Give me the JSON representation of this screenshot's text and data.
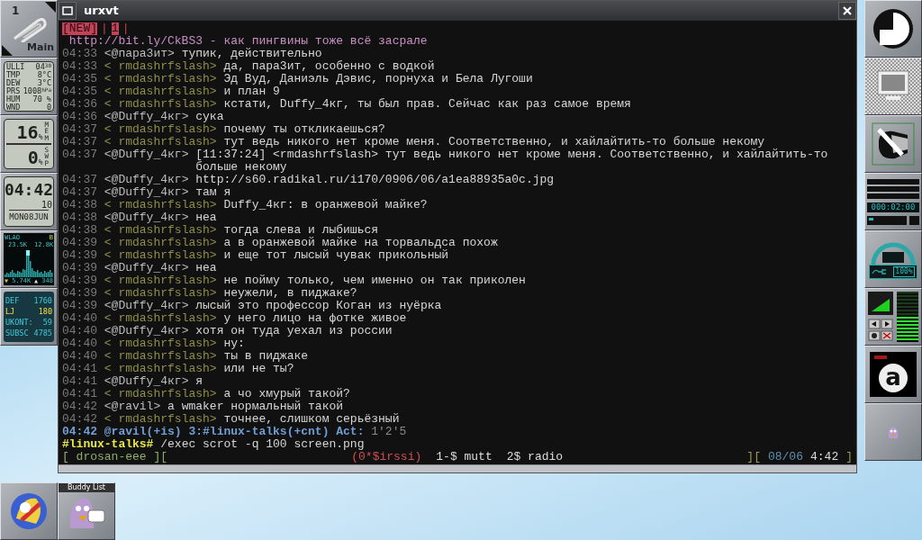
{
  "left_dock": {
    "workspace": {
      "number": "1",
      "name": "Main"
    },
    "weather": [
      {
        "label": "ULLI",
        "value": "04$^{30}$"
      },
      {
        "label": "TMP",
        "value": "8°C"
      },
      {
        "label": "DEW",
        "value": "3°C"
      },
      {
        "label": "PRS",
        "value": "1008$^{hPa}$"
      },
      {
        "label": "HUM",
        "value": "70 %"
      },
      {
        "label": "WND",
        "value": "0"
      }
    ],
    "memory": [
      {
        "value": "16",
        "unit": "%",
        "label": "MEM"
      },
      {
        "value": "0",
        "unit": "%",
        "label": "SWP"
      }
    ],
    "clock": {
      "time": "04:42",
      "seconds": "10",
      "date": "MON08JUN"
    },
    "network": {
      "interface": "WLAO",
      "flag": "B",
      "rx_total": "23.5K",
      "tx_total": "12.8K",
      "rx_rate": "5.74K",
      "tx_rate": "348"
    },
    "counters": [
      {
        "label": "DEF",
        "value": "1760",
        "highlighted": false
      },
      {
        "label": "LJ",
        "value": "180",
        "highlighted": true
      },
      {
        "label": "UKONT:",
        "value": "59",
        "highlighted": false
      },
      {
        "label": "SUBSC",
        "value": "4785",
        "highlighted": false
      }
    ]
  },
  "window": {
    "title": "urxvt"
  },
  "terminal": {
    "tabs": [
      {
        "label": "[NEW]",
        "kind": "hot"
      },
      {
        "label": "|",
        "kind": "sep"
      },
      {
        "label": "1",
        "kind": "hot"
      },
      {
        "label": "|",
        "kind": "sep"
      }
    ],
    "topic": " http://bit.ly/CkBS3 - как пингвины тоже всё засрале",
    "messages": [
      {
        "time": "04:33",
        "nick": "<@пара3ит>",
        "own": false,
        "text": "тупик, действительно"
      },
      {
        "time": "04:33",
        "nick": "< rmdashrfslash>",
        "own": true,
        "text": "да, пара3ит, особенно с водкой"
      },
      {
        "time": "04:35",
        "nick": "< rmdashrfslash>",
        "own": true,
        "text": "Эд Вуд, Даниэль Дэвис, порнуха и Бела Лугоши"
      },
      {
        "time": "04:35",
        "nick": "< rmdashrfslash>",
        "own": true,
        "text": "и план 9"
      },
      {
        "time": "04:36",
        "nick": "< rmdashrfslash>",
        "own": true,
        "text": "кстати, Duffy_4кг, ты был прав. Сейчас как раз самое время"
      },
      {
        "time": "04:36",
        "nick": "<@Duffy_4кг>",
        "own": false,
        "text": "сука"
      },
      {
        "time": "04:37",
        "nick": "< rmdashrfslash>",
        "own": true,
        "text": "почему ты откликаешься?"
      },
      {
        "time": "04:37",
        "nick": "< rmdashrfslash>",
        "own": true,
        "text": "тут ведь никого нет кроме меня. Соответственно, и хайлайтить-то больше некому"
      },
      {
        "time": "04:37",
        "nick": "<@Duffy_4кг>",
        "own": false,
        "text": "[11:37:24] <rmdashrfslash> тут ведь никого нет кроме меня. Соответственно, и хайлайтить-то больше некому"
      },
      {
        "time": "04:37",
        "nick": "<@Duffy_4кг>",
        "own": false,
        "text": "http://s60.radikal.ru/i170/0906/06/a1ea88935a0c.jpg"
      },
      {
        "time": "04:37",
        "nick": "<@Duffy_4кг>",
        "own": false,
        "text": "там я"
      },
      {
        "time": "04:38",
        "nick": "< rmdashrfslash>",
        "own": true,
        "text": "Duffy_4кг: в оранжевой майке?"
      },
      {
        "time": "04:38",
        "nick": "<@Duffy_4кг>",
        "own": false,
        "text": "неа"
      },
      {
        "time": "04:38",
        "nick": "< rmdashrfslash>",
        "own": true,
        "text": "тогда слева и лыбишься"
      },
      {
        "time": "04:39",
        "nick": "< rmdashrfslash>",
        "own": true,
        "text": "а в оранжевой майке на торвальдса похож"
      },
      {
        "time": "04:39",
        "nick": "< rmdashrfslash>",
        "own": true,
        "text": "и еще тот лысый чувак прикольный"
      },
      {
        "time": "04:39",
        "nick": "<@Duffy_4кг>",
        "own": false,
        "text": "неа"
      },
      {
        "time": "04:39",
        "nick": "< rmdashrfslash>",
        "own": true,
        "text": "не пойму только, чем именно он так приколен"
      },
      {
        "time": "04:39",
        "nick": "< rmdashrfslash>",
        "own": true,
        "text": "неужели, в пиджаке?"
      },
      {
        "time": "04:39",
        "nick": "<@Duffy_4кг>",
        "own": false,
        "text": "лысый это профессор Коган из нуёрка"
      },
      {
        "time": "04:40",
        "nick": "< rmdashrfslash>",
        "own": true,
        "text": "у него лицо на фотке живое"
      },
      {
        "time": "04:40",
        "nick": "<@Duffy_4кг>",
        "own": false,
        "text": "хотя он туда уехал из россии"
      },
      {
        "time": "04:40",
        "nick": "< rmdashrfslash>",
        "own": true,
        "text": "ну:"
      },
      {
        "time": "04:40",
        "nick": "< rmdashrfslash>",
        "own": true,
        "text": "ты в пиджаке"
      },
      {
        "time": "04:41",
        "nick": "< rmdashrfslash>",
        "own": true,
        "text": "или не ты?"
      },
      {
        "time": "04:41",
        "nick": "<@Duffy_4кг>",
        "own": false,
        "text": "я"
      },
      {
        "time": "04:41",
        "nick": "< rmdashrfslash>",
        "own": true,
        "text": "а чо хмурый такой?"
      },
      {
        "time": "04:42",
        "nick": "<@ravil>",
        "own": false,
        "text": "а wmaker нормальный такой"
      },
      {
        "time": "04:42",
        "nick": "< rmdashrfslash>",
        "own": true,
        "text": "точнее, слишком серьёзный"
      }
    ],
    "status_line": {
      "info": "04:42 @ravil(+is) 3:#linux-talks(+cnt) Act:",
      "activity": "1'2'5"
    },
    "input": {
      "prompt": "#linux-talks#",
      "value": "/exec scrot -q 100 screen.png"
    },
    "screen_bar": {
      "left": [
        {
          "text": "[ drosan-eee ][",
          "kind": "host"
        }
      ],
      "center": [
        {
          "text": "(0*$irssi)",
          "kind": "current"
        },
        {
          "text": "1-$ mutt",
          "kind": "window"
        },
        {
          "text": "2$ radio",
          "kind": "window"
        }
      ],
      "right": [
        {
          "text": "][",
          "kind": "bracket"
        },
        {
          "text": "08/06",
          "kind": "date"
        },
        {
          "text": "4:42",
          "kind": "time"
        },
        {
          "text": "]",
          "kind": "bracket"
        }
      ]
    }
  },
  "right_dock": {
    "cd_player": {
      "time": "000:02:00"
    },
    "battery": {
      "charge": "100%"
    },
    "mixer": {
      "level": 0.5
    },
    "letter_app": {
      "letter": "a"
    }
  },
  "bottom": {
    "buddy_list": {
      "title": "Buddy List"
    }
  }
}
